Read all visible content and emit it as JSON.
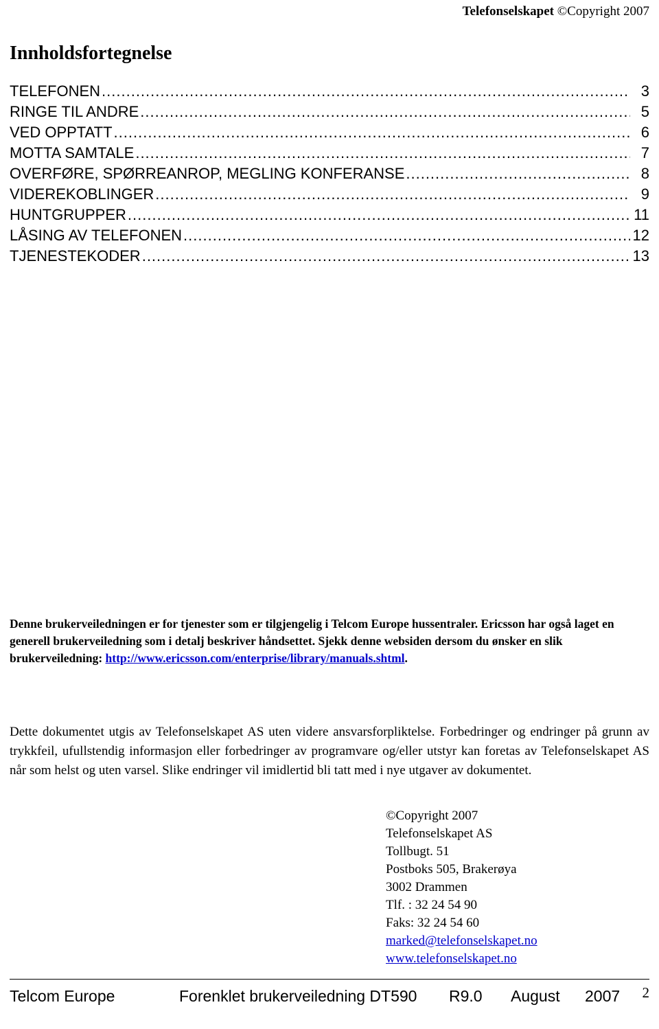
{
  "header": {
    "brand": "Telefonselskapet",
    "copyright": "©Copyright 2007"
  },
  "toc": {
    "title": "Innholdsfortegnelse",
    "entries": [
      {
        "label": "TELEFONEN",
        "page": "3"
      },
      {
        "label": "RINGE TIL ANDRE",
        "page": "5"
      },
      {
        "label": "VED OPPTATT",
        "page": "6"
      },
      {
        "label": "MOTTA SAMTALE",
        "page": "7"
      },
      {
        "label": "OVERFØRE, SPØRREANROP, MEGLING KONFERANSE",
        "page": "8"
      },
      {
        "label": "VIDEREKOBLINGER",
        "page": "9"
      },
      {
        "label": "HUNTGRUPPER",
        "page": "11"
      },
      {
        "label": "LÅSING AV TELEFONEN",
        "page": "12"
      },
      {
        "label": "TJENESTEKODER",
        "page": "13"
      }
    ]
  },
  "intro": {
    "text_before_link": "Denne brukerveiledningen er for tjenester som er tilgjengelig i Telcom Europe hussentraler.  Ericsson har også laget en generell brukerveiledning som i detalj beskriver håndsettet.  Sjekk denne websiden dersom du ønsker en slik brukerveiledning: ",
    "link": "http://www.ericsson.com/enterprise/library/manuals.shtml",
    "text_after_link": "."
  },
  "disclaimer": {
    "text": "Dette dokumentet utgis av Telefonselskapet AS uten videre ansvarsforpliktelse.  Forbedringer og endringer på grunn av trykkfeil, ufullstendig informasjon eller forbedringer av programvare og/eller utstyr kan foretas av Telefonselskapet AS når som helst og uten varsel.  Slike endringer vil imidlertid bli tatt med i nye utgaver av dokumentet."
  },
  "address": {
    "lines": [
      "©Copyright 2007",
      "Telefonselskapet AS",
      "Tollbugt. 51",
      "Postboks 505, Brakerøya",
      "3002 Drammen",
      "Tlf. :  32 24 54 90",
      "Faks:  32 24 54 60"
    ],
    "email": "marked@telefonselskapet.no",
    "website": "www.telefonselskapet.no"
  },
  "footer": {
    "company": "Telcom Europe",
    "doc_title": "Forenklet brukerveiledning DT590",
    "revision": "R9.0",
    "month": "August",
    "year": "2007",
    "page_number": "2"
  }
}
